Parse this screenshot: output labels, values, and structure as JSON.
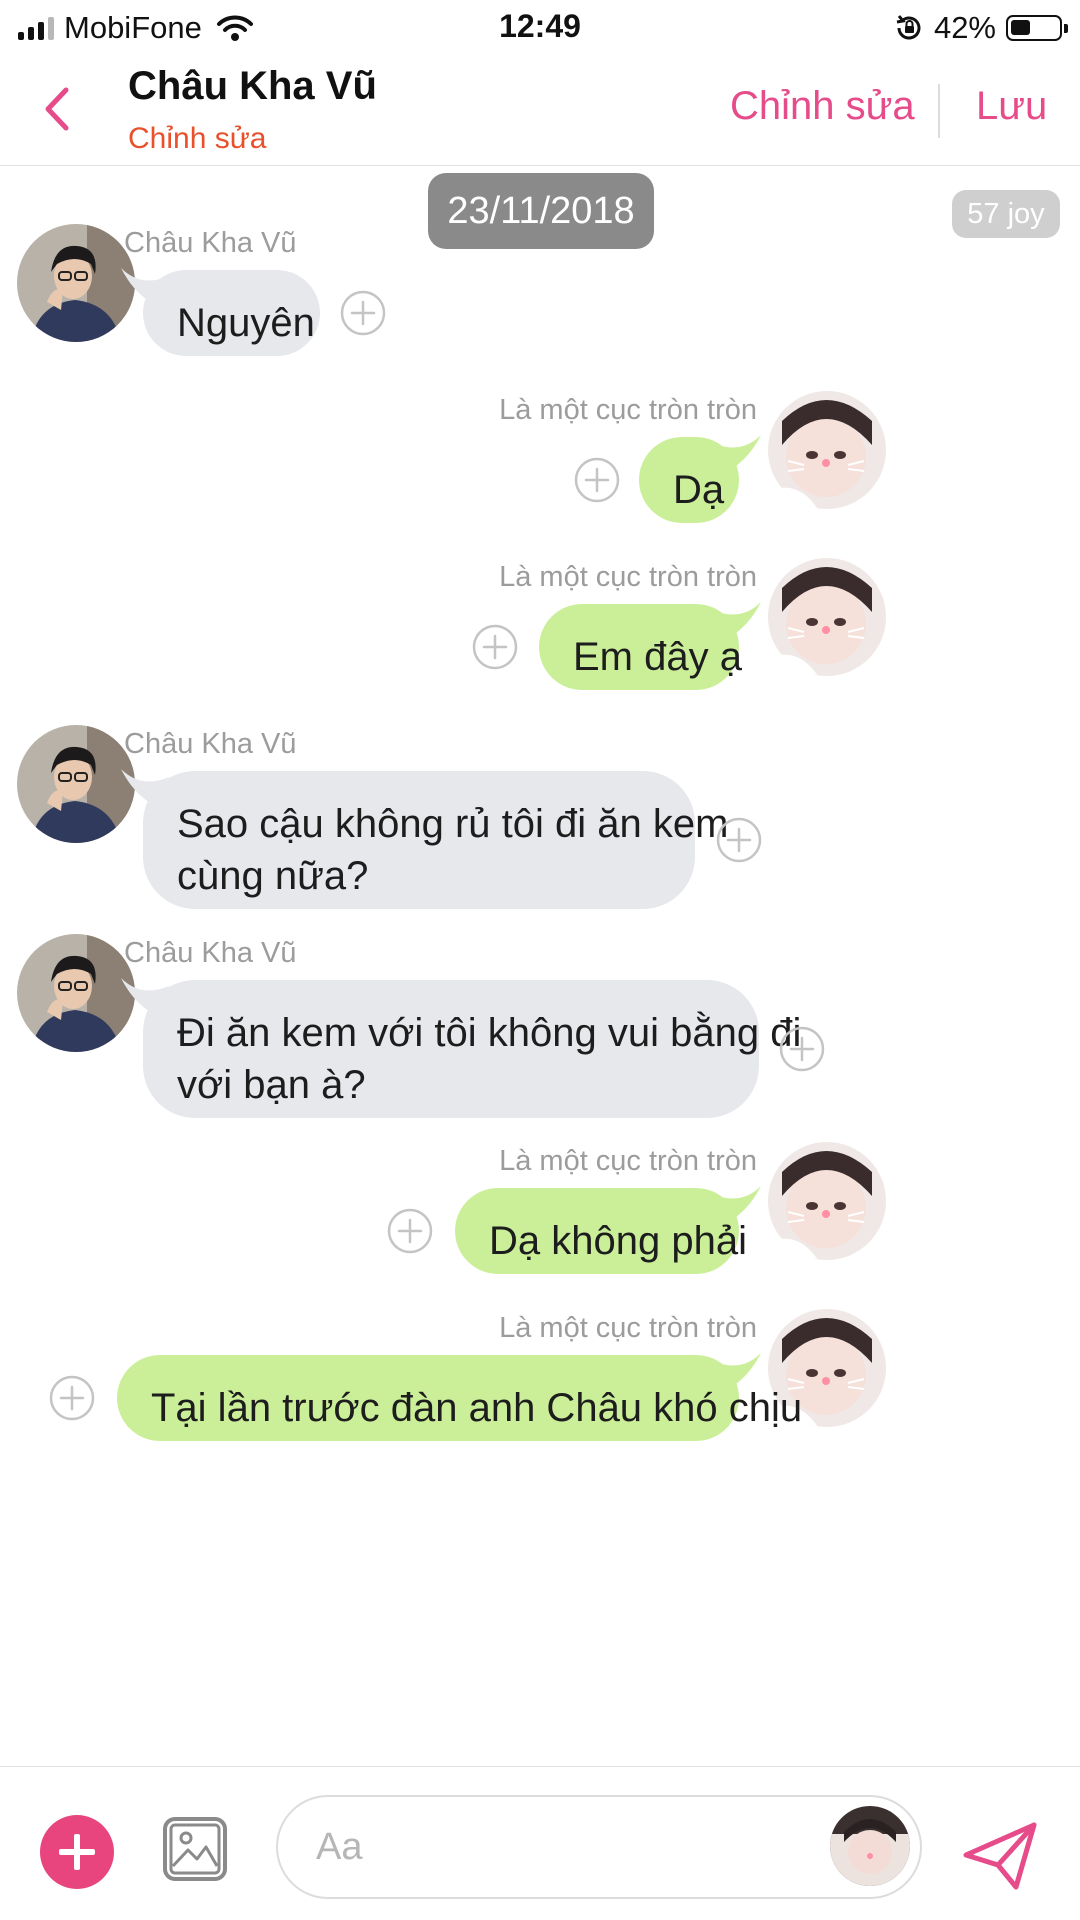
{
  "status_bar": {
    "carrier": "MobiFone",
    "time": "12:49",
    "battery_percent": "42%",
    "battery_level": 0.42
  },
  "header": {
    "name": "Châu Kha Vũ",
    "subtitle": "Chỉnh sửa",
    "edit_label": "Chỉnh sửa",
    "save_label": "Lưu"
  },
  "chat": {
    "date": "23/11/2018",
    "joy_badge": "57 joy",
    "messages": [
      {
        "side": "left",
        "sender": "Châu Kha Vũ",
        "lines": [
          "Nguyên"
        ]
      },
      {
        "side": "right",
        "sender": "Là một cục tròn tròn",
        "lines": [
          "Dạ"
        ]
      },
      {
        "side": "right",
        "sender": "Là một cục tròn tròn",
        "lines": [
          "Em đây ạ"
        ]
      },
      {
        "side": "left",
        "sender": "Châu Kha Vũ",
        "lines": [
          "Sao cậu không rủ tôi đi ăn kem",
          "cùng nữa?"
        ]
      },
      {
        "side": "left",
        "sender": "Châu Kha Vũ",
        "lines": [
          "Đi ăn kem với tôi không vui bằng đi",
          "với bạn à?"
        ]
      },
      {
        "side": "right",
        "sender": "Là một cục tròn tròn",
        "lines": [
          "Dạ không phải"
        ]
      },
      {
        "side": "right",
        "sender": "Là một cục tròn tròn",
        "lines": [
          "Tại lần trước đàn anh Châu khó chịu"
        ]
      }
    ]
  },
  "input": {
    "placeholder": "Aa"
  },
  "colors": {
    "accent": "#e64b8a",
    "subtitle": "#e8512c",
    "bubble_left": "#e6e8ec",
    "bubble_right": "#cbef99",
    "date_pill": "#8a8a8a"
  },
  "icons": {
    "back": "chevron-left-icon",
    "add": "plus-icon",
    "image": "image-icon",
    "send": "paper-plane-icon",
    "react": "add-reaction-icon"
  }
}
